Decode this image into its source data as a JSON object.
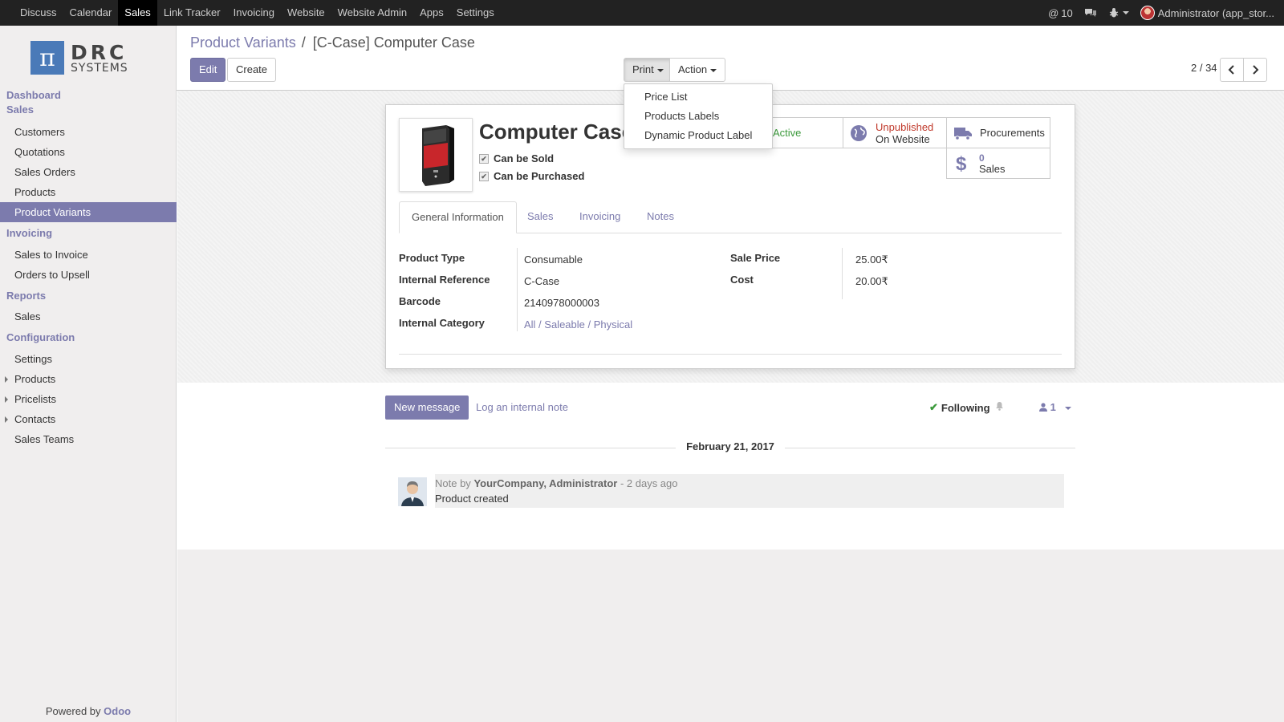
{
  "topbar": {
    "menu": [
      "Discuss",
      "Calendar",
      "Sales",
      "Link Tracker",
      "Invoicing",
      "Website",
      "Website Admin",
      "Apps",
      "Settings"
    ],
    "active": "Sales",
    "mentions": "10",
    "user": "Administrator (app_stor..."
  },
  "logo": {
    "letter": "π",
    "big": "DRC",
    "small": "SYSTEMS"
  },
  "sidebar": {
    "sections": [
      {
        "title": "Dashboard",
        "items": []
      },
      {
        "title": "Sales",
        "items": [
          {
            "label": "Customers"
          },
          {
            "label": "Quotations"
          },
          {
            "label": "Sales Orders"
          },
          {
            "label": "Products"
          },
          {
            "label": "Product Variants",
            "active": true
          }
        ]
      },
      {
        "title": "Invoicing",
        "items": [
          {
            "label": "Sales to Invoice"
          },
          {
            "label": "Orders to Upsell"
          }
        ]
      },
      {
        "title": "Reports",
        "items": [
          {
            "label": "Sales"
          }
        ]
      },
      {
        "title": "Configuration",
        "items": [
          {
            "label": "Settings"
          },
          {
            "label": "Products",
            "expandable": true
          },
          {
            "label": "Pricelists",
            "expandable": true
          },
          {
            "label": "Contacts",
            "expandable": true
          },
          {
            "label": "Sales Teams"
          }
        ]
      }
    ],
    "powered_prefix": "Powered by",
    "powered_brand": "Odoo"
  },
  "breadcrumb": {
    "parent": "Product Variants",
    "separator": "/",
    "current": "[C-Case] Computer Case"
  },
  "toolbar": {
    "edit": "Edit",
    "create": "Create",
    "print": "Print",
    "action": "Action",
    "pager": "2 / 34"
  },
  "print_menu": [
    "Price List",
    "Products Labels",
    "Dynamic Product Label"
  ],
  "product": {
    "name": "Computer Case",
    "can_be_sold": "Can be Sold",
    "can_be_purchased": "Can be Purchased",
    "active_label": "Active",
    "website_status": "Unpublished",
    "website_sub": "On Website",
    "procurements": "Procurements",
    "sales_count": "0",
    "sales_label": "Sales"
  },
  "tabs": [
    "General Information",
    "Sales",
    "Invoicing",
    "Notes"
  ],
  "fields_left": [
    {
      "label": "Product Type",
      "value": "Consumable"
    },
    {
      "label": "Internal Reference",
      "value": "C-Case"
    },
    {
      "label": "Barcode",
      "value": "2140978000003"
    },
    {
      "label": "Internal Category",
      "value": "All / Saleable / Physical",
      "link": true
    }
  ],
  "fields_right": [
    {
      "label": "Sale Price",
      "value": "25.00₹"
    },
    {
      "label": "Cost",
      "value": "20.00₹"
    }
  ],
  "chatter": {
    "new_message": "New message",
    "log_note": "Log an internal note",
    "following": "Following",
    "followers": "1",
    "date": "February 21, 2017",
    "message": {
      "prefix": "Note by",
      "author": "YourCompany, Administrator",
      "time": "- 2 days ago",
      "body": "Product created"
    }
  },
  "colors": {
    "brand": "#7c7bad",
    "topbar": "#222222",
    "active_green": "#3c9a3c",
    "unpublished_red": "#c0392b"
  }
}
